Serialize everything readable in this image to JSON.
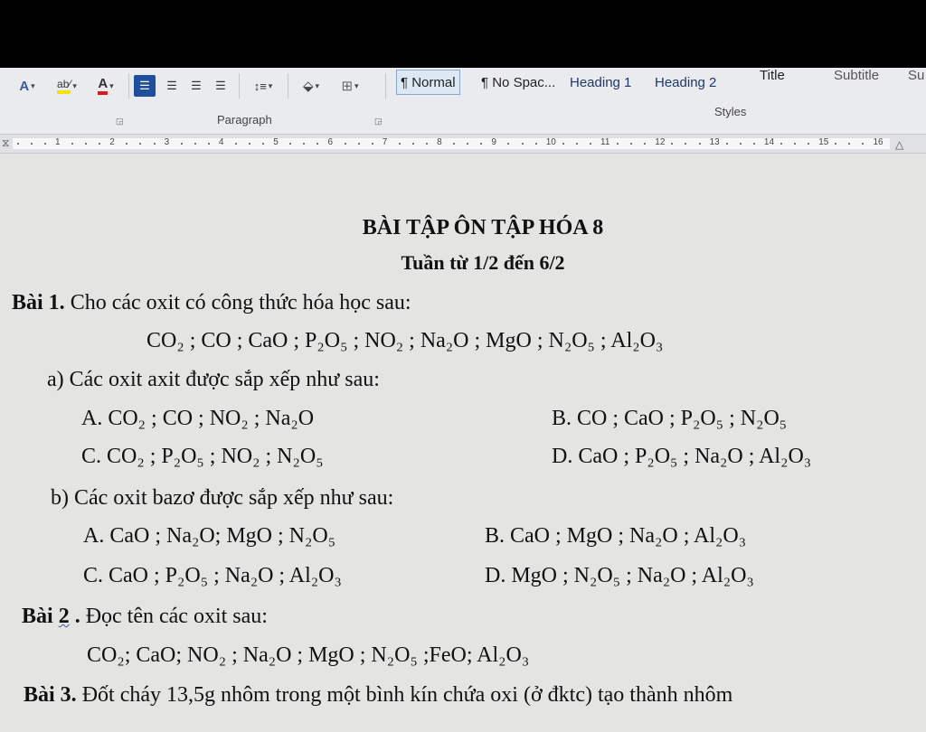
{
  "ribbon": {
    "tools": {
      "text_effects": "A",
      "highlight": "ab⁄",
      "font_color": "A",
      "line_spacing": "↕≡",
      "shading": "⬙",
      "borders": "⊞"
    },
    "styles": [
      {
        "label": "¶ Normal",
        "selected": true
      },
      {
        "label": "¶ No Spac...",
        "selected": false
      },
      {
        "label": "Heading 1",
        "selected": false
      },
      {
        "label": "Heading 2",
        "selected": false
      },
      {
        "label": "Title",
        "selected": false
      },
      {
        "label": "Subtitle",
        "selected": false
      },
      {
        "label": "Su",
        "selected": false
      }
    ],
    "group_paragraph": "Paragraph",
    "group_styles": "Styles"
  },
  "ruler": {
    "numbers": [
      "1",
      "2",
      "3",
      "4",
      "5",
      "6",
      "7",
      "8",
      "9",
      "10",
      "11",
      "12",
      "13",
      "14",
      "15",
      "16"
    ]
  },
  "document": {
    "title": "BÀI TẬP ÔN TẬP HÓA 8",
    "subtitle": "Tuần từ 1/2 đến 6/2",
    "bai1": {
      "label": "Bài 1.",
      "text": " Cho các oxit có công thức hóa học sau:",
      "formulas": "CO₂ ; CO ; CaO ; P₂O₅ ; NO₂ ; Na₂O ; MgO ; N₂O₅ ; Al₂O₃",
      "a_question": "a) Các oxit axit được sắp xếp như sau:",
      "a_options": {
        "A": "A. CO₂ ; CO ; NO₂ ; Na₂O",
        "B": "B. CO ; CaO ; P₂O₅ ; N₂O₅",
        "C": "C. CO₂ ; P₂O₅ ; NO₂ ; N₂O₅",
        "D": "D. CaO ; P₂O₅ ; Na₂O ; Al₂O₃"
      },
      "b_question": "b) Các oxit bazơ được sắp xếp như sau:",
      "b_options": {
        "A": "A. CaO ; Na₂O; MgO ; N₂O₅",
        "B": "B. CaO ; MgO ; Na₂O ; Al₂O₃",
        "C": "C. CaO ; P₂O₅ ; Na₂O ; Al₂O₃",
        "D": "D. MgO ; N₂O₅ ; Na₂O ; Al₂O₃"
      }
    },
    "bai2": {
      "label_prefix": "Bài ",
      "label_num": "2",
      "label_suffix": " .",
      "text": " Đọc tên các oxit sau:",
      "formulas": "CO₂; CaO; NO₂ ; Na₂O ; MgO ; N₂O₅ ;FeO;  Al₂O₃"
    },
    "bai3": {
      "label": "Bài 3.",
      "text": " Đốt cháy 13,5g nhôm trong một bình kín chứa oxi (ở đktc) tạo thành nhôm"
    }
  }
}
